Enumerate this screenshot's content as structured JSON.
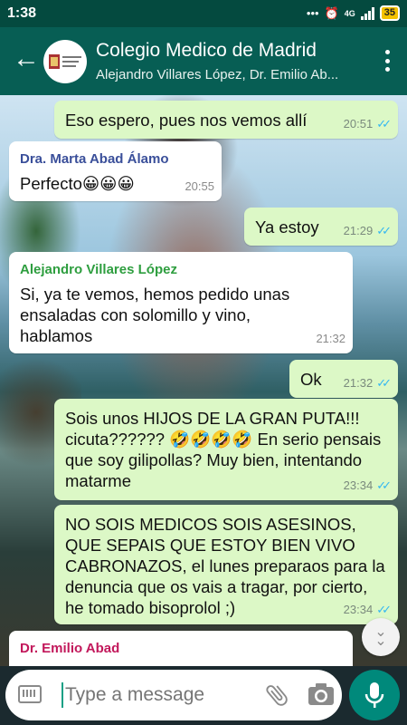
{
  "status_bar": {
    "time": "1:38",
    "network": "4G",
    "battery": "35",
    "icons": [
      "dots-icon",
      "alarm-icon",
      "signal-icon",
      "battery-icon"
    ]
  },
  "header": {
    "title": "Colegio Medico de Madrid",
    "subtitle": "Alejandro Villares López, Dr. Emilio Ab...",
    "icons": [
      "back-arrow-icon",
      "group-avatar",
      "overflow-menu-icon"
    ]
  },
  "messages": [
    {
      "direction": "out",
      "text": "Eso espero, pues nos vemos allí",
      "time": "20:51",
      "read": true
    },
    {
      "direction": "in",
      "sender": "Dra. Marta Abad Álamo",
      "sender_color": "#3a4f9a",
      "text": "Perfecto😀😀😀",
      "time": "20:55"
    },
    {
      "direction": "out",
      "text": "Ya estoy",
      "time": "21:29",
      "read": true
    },
    {
      "direction": "in",
      "sender": "Alejandro Villares López",
      "sender_color": "#2e9e3f",
      "text": "Si, ya te vemos, hemos pedido unas ensaladas con solomillo y vino, hablamos",
      "time": "21:32"
    },
    {
      "direction": "out",
      "text": "Ok",
      "time": "21:32",
      "read": true
    },
    {
      "direction": "out",
      "text": "Sois unos HIJOS DE LA GRAN PUTA!!! cicuta?????? 🤣🤣🤣🤣 En serio pensais que soy gilipollas? Muy bien, intentando matarme",
      "time": "23:34",
      "read": true
    },
    {
      "direction": "out",
      "text": "NO SOIS MEDICOS SOIS ASESINOS, QUE SEPAIS QUE ESTOY BIEN VIVO CABRONAZOS, el lunes preparaos para la denuncia que os vais a tragar, por cierto, he tomado bisoprolol ;)",
      "time": "23:34",
      "read": true
    },
    {
      "direction": "in",
      "sender": "Dr. Emilio Abad",
      "sender_color": "#c2185b",
      "text": "",
      "time": ""
    }
  ],
  "input": {
    "placeholder": "Type a message",
    "icons": [
      "keyboard-icon",
      "attach-icon",
      "camera-icon",
      "mic-icon",
      "scroll-down-icon"
    ]
  },
  "colors": {
    "header": "#075e54",
    "status_bar": "#044a3f",
    "outgoing_bubble": "#dcf8c6",
    "incoming_bubble": "#ffffff",
    "read_ticks": "#34b7f1",
    "mic_button": "#00897b"
  }
}
